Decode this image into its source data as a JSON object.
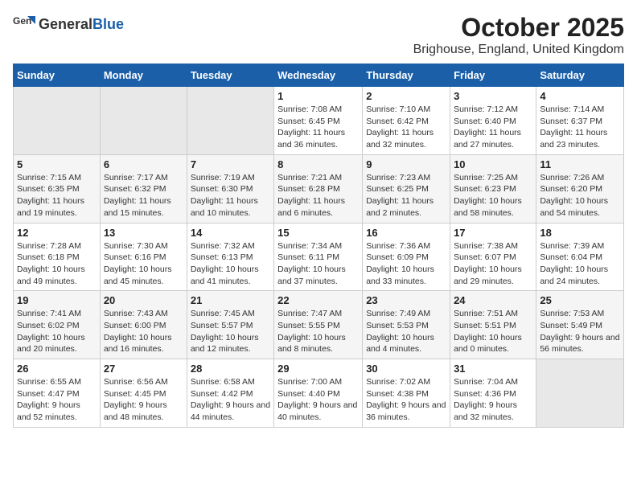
{
  "logo": {
    "general": "General",
    "blue": "Blue"
  },
  "title": "October 2025",
  "subtitle": "Brighouse, England, United Kingdom",
  "weekdays": [
    "Sunday",
    "Monday",
    "Tuesday",
    "Wednesday",
    "Thursday",
    "Friday",
    "Saturday"
  ],
  "weeks": [
    [
      {
        "day": "",
        "sunrise": "",
        "sunset": "",
        "daylight": ""
      },
      {
        "day": "",
        "sunrise": "",
        "sunset": "",
        "daylight": ""
      },
      {
        "day": "",
        "sunrise": "",
        "sunset": "",
        "daylight": ""
      },
      {
        "day": "1",
        "sunrise": "Sunrise: 7:08 AM",
        "sunset": "Sunset: 6:45 PM",
        "daylight": "Daylight: 11 hours and 36 minutes."
      },
      {
        "day": "2",
        "sunrise": "Sunrise: 7:10 AM",
        "sunset": "Sunset: 6:42 PM",
        "daylight": "Daylight: 11 hours and 32 minutes."
      },
      {
        "day": "3",
        "sunrise": "Sunrise: 7:12 AM",
        "sunset": "Sunset: 6:40 PM",
        "daylight": "Daylight: 11 hours and 27 minutes."
      },
      {
        "day": "4",
        "sunrise": "Sunrise: 7:14 AM",
        "sunset": "Sunset: 6:37 PM",
        "daylight": "Daylight: 11 hours and 23 minutes."
      }
    ],
    [
      {
        "day": "5",
        "sunrise": "Sunrise: 7:15 AM",
        "sunset": "Sunset: 6:35 PM",
        "daylight": "Daylight: 11 hours and 19 minutes."
      },
      {
        "day": "6",
        "sunrise": "Sunrise: 7:17 AM",
        "sunset": "Sunset: 6:32 PM",
        "daylight": "Daylight: 11 hours and 15 minutes."
      },
      {
        "day": "7",
        "sunrise": "Sunrise: 7:19 AM",
        "sunset": "Sunset: 6:30 PM",
        "daylight": "Daylight: 11 hours and 10 minutes."
      },
      {
        "day": "8",
        "sunrise": "Sunrise: 7:21 AM",
        "sunset": "Sunset: 6:28 PM",
        "daylight": "Daylight: 11 hours and 6 minutes."
      },
      {
        "day": "9",
        "sunrise": "Sunrise: 7:23 AM",
        "sunset": "Sunset: 6:25 PM",
        "daylight": "Daylight: 11 hours and 2 minutes."
      },
      {
        "day": "10",
        "sunrise": "Sunrise: 7:25 AM",
        "sunset": "Sunset: 6:23 PM",
        "daylight": "Daylight: 10 hours and 58 minutes."
      },
      {
        "day": "11",
        "sunrise": "Sunrise: 7:26 AM",
        "sunset": "Sunset: 6:20 PM",
        "daylight": "Daylight: 10 hours and 54 minutes."
      }
    ],
    [
      {
        "day": "12",
        "sunrise": "Sunrise: 7:28 AM",
        "sunset": "Sunset: 6:18 PM",
        "daylight": "Daylight: 10 hours and 49 minutes."
      },
      {
        "day": "13",
        "sunrise": "Sunrise: 7:30 AM",
        "sunset": "Sunset: 6:16 PM",
        "daylight": "Daylight: 10 hours and 45 minutes."
      },
      {
        "day": "14",
        "sunrise": "Sunrise: 7:32 AM",
        "sunset": "Sunset: 6:13 PM",
        "daylight": "Daylight: 10 hours and 41 minutes."
      },
      {
        "day": "15",
        "sunrise": "Sunrise: 7:34 AM",
        "sunset": "Sunset: 6:11 PM",
        "daylight": "Daylight: 10 hours and 37 minutes."
      },
      {
        "day": "16",
        "sunrise": "Sunrise: 7:36 AM",
        "sunset": "Sunset: 6:09 PM",
        "daylight": "Daylight: 10 hours and 33 minutes."
      },
      {
        "day": "17",
        "sunrise": "Sunrise: 7:38 AM",
        "sunset": "Sunset: 6:07 PM",
        "daylight": "Daylight: 10 hours and 29 minutes."
      },
      {
        "day": "18",
        "sunrise": "Sunrise: 7:39 AM",
        "sunset": "Sunset: 6:04 PM",
        "daylight": "Daylight: 10 hours and 24 minutes."
      }
    ],
    [
      {
        "day": "19",
        "sunrise": "Sunrise: 7:41 AM",
        "sunset": "Sunset: 6:02 PM",
        "daylight": "Daylight: 10 hours and 20 minutes."
      },
      {
        "day": "20",
        "sunrise": "Sunrise: 7:43 AM",
        "sunset": "Sunset: 6:00 PM",
        "daylight": "Daylight: 10 hours and 16 minutes."
      },
      {
        "day": "21",
        "sunrise": "Sunrise: 7:45 AM",
        "sunset": "Sunset: 5:57 PM",
        "daylight": "Daylight: 10 hours and 12 minutes."
      },
      {
        "day": "22",
        "sunrise": "Sunrise: 7:47 AM",
        "sunset": "Sunset: 5:55 PM",
        "daylight": "Daylight: 10 hours and 8 minutes."
      },
      {
        "day": "23",
        "sunrise": "Sunrise: 7:49 AM",
        "sunset": "Sunset: 5:53 PM",
        "daylight": "Daylight: 10 hours and 4 minutes."
      },
      {
        "day": "24",
        "sunrise": "Sunrise: 7:51 AM",
        "sunset": "Sunset: 5:51 PM",
        "daylight": "Daylight: 10 hours and 0 minutes."
      },
      {
        "day": "25",
        "sunrise": "Sunrise: 7:53 AM",
        "sunset": "Sunset: 5:49 PM",
        "daylight": "Daylight: 9 hours and 56 minutes."
      }
    ],
    [
      {
        "day": "26",
        "sunrise": "Sunrise: 6:55 AM",
        "sunset": "Sunset: 4:47 PM",
        "daylight": "Daylight: 9 hours and 52 minutes."
      },
      {
        "day": "27",
        "sunrise": "Sunrise: 6:56 AM",
        "sunset": "Sunset: 4:45 PM",
        "daylight": "Daylight: 9 hours and 48 minutes."
      },
      {
        "day": "28",
        "sunrise": "Sunrise: 6:58 AM",
        "sunset": "Sunset: 4:42 PM",
        "daylight": "Daylight: 9 hours and 44 minutes."
      },
      {
        "day": "29",
        "sunrise": "Sunrise: 7:00 AM",
        "sunset": "Sunset: 4:40 PM",
        "daylight": "Daylight: 9 hours and 40 minutes."
      },
      {
        "day": "30",
        "sunrise": "Sunrise: 7:02 AM",
        "sunset": "Sunset: 4:38 PM",
        "daylight": "Daylight: 9 hours and 36 minutes."
      },
      {
        "day": "31",
        "sunrise": "Sunrise: 7:04 AM",
        "sunset": "Sunset: 4:36 PM",
        "daylight": "Daylight: 9 hours and 32 minutes."
      },
      {
        "day": "",
        "sunrise": "",
        "sunset": "",
        "daylight": ""
      }
    ]
  ]
}
